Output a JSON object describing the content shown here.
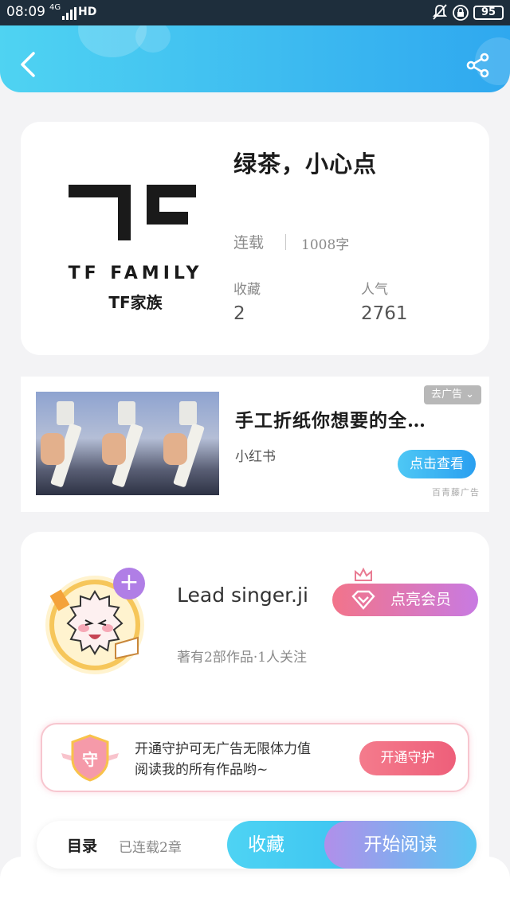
{
  "status_bar": {
    "time": "08:09",
    "network": "4G",
    "hd": "HD",
    "battery": "95",
    "icons": [
      "signal-icon",
      "bell-off-icon",
      "lock-icon",
      "battery-icon"
    ]
  },
  "header": {
    "back_icon": "chevron-left-icon",
    "share_icon": "share-icon",
    "accent_start": "#4fd3f2",
    "accent_end": "#2fa8ef"
  },
  "book": {
    "cover": {
      "logo_text": "TF FAMILY",
      "logo_cn": "TF家族"
    },
    "title": "绿茶，小心点",
    "status": "连载",
    "words": "1008字",
    "stats": [
      {
        "label": "收藏",
        "value": "2"
      },
      {
        "label": "人气",
        "value": "2761"
      }
    ]
  },
  "ad": {
    "title": "手工折纸你想要的全…",
    "source": "小红书",
    "close_label": "去广告 ⌄",
    "cta": "点击查看",
    "mark": "百青藤广告"
  },
  "author": {
    "name": "Lead singer.ji",
    "meta": "著有2部作品·1人关注",
    "plus": "+",
    "vip_button": "点亮会员",
    "guard": {
      "badge": "守",
      "line1": "开通守护可无广告无限体力值",
      "line2": "阅读我的所有作品哟~",
      "button": "开通守护"
    }
  },
  "bottom": {
    "toc": "目录",
    "chapters": "已连载2章",
    "collect": "收藏",
    "read": "开始阅读"
  }
}
